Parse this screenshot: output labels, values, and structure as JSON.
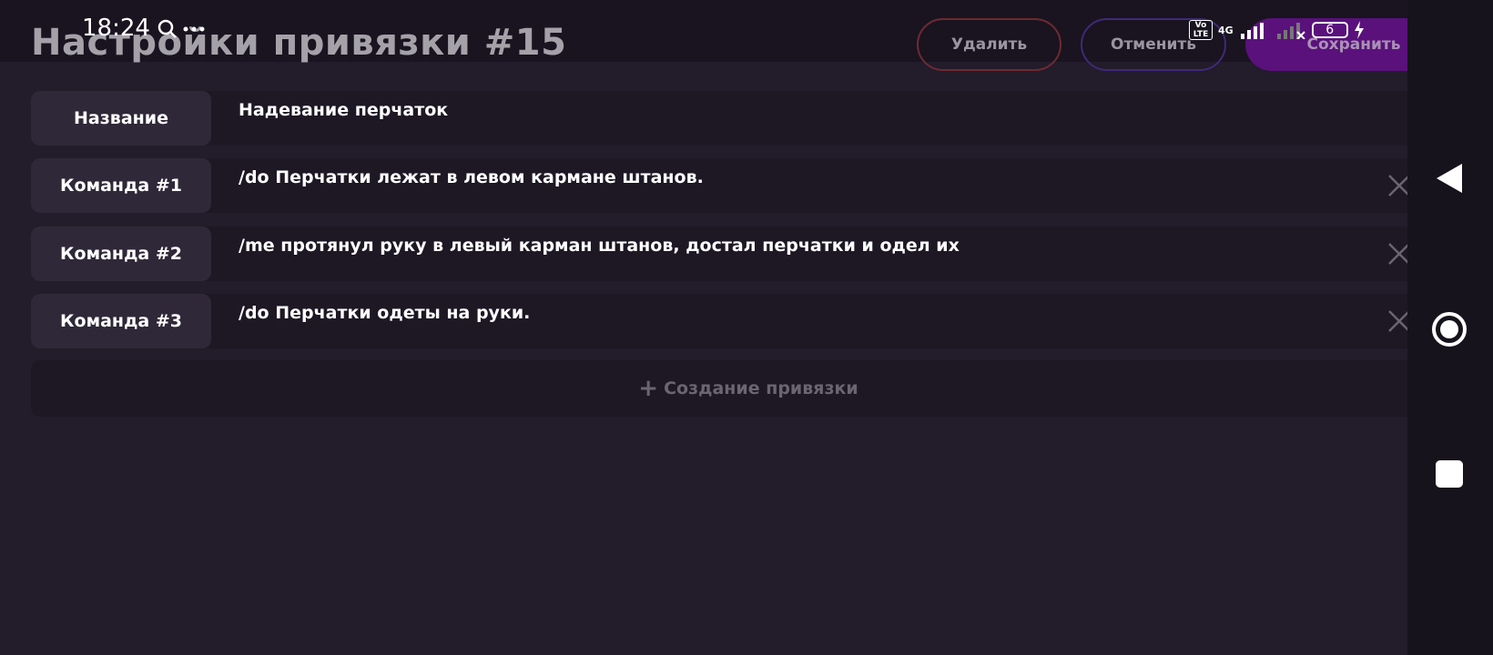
{
  "status_bar": {
    "time": "18:24",
    "volte": "Vo LTE",
    "network": "4G",
    "battery": "6"
  },
  "header": {
    "title": "Настройки привязки #15",
    "delete_label": "Удалить",
    "cancel_label": "Отменить",
    "save_label": "Сохранить"
  },
  "rows": [
    {
      "label": "Название",
      "value": "Надевание перчаток"
    },
    {
      "label": "Команда #1",
      "value": "/do Перчатки лежат в левом кармане штанов."
    },
    {
      "label": "Команда #2",
      "value": "/me протянул руку в левый карман штанов, достал перчатки и одел их"
    },
    {
      "label": "Команда #3",
      "value": "/do Перчатки одеты на руки."
    }
  ],
  "add_binding_label": "Создание привязки",
  "colors": {
    "background": "#221c2b",
    "label_bg": "#2f2838",
    "accent_save": "#5a117c",
    "delete_border": "#6e2a33",
    "cancel_border": "#3e2a79"
  }
}
